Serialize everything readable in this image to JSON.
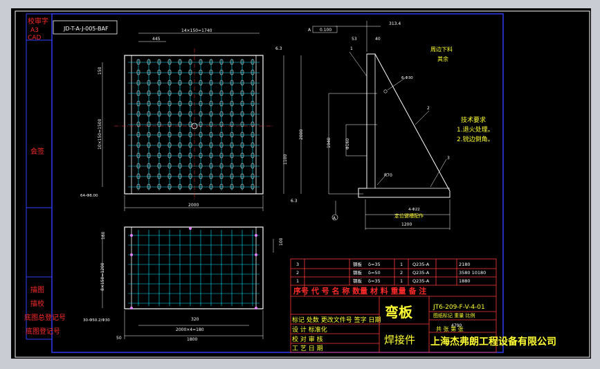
{
  "sheet": {
    "doc_code": "JD-T-A-J-005-BAF",
    "size": "A3",
    "cad": "CAD",
    "left_labels": {
      "top": "校审字",
      "mid": "会签",
      "b1": "描图",
      "b2": "描校",
      "b3": "底图总登记号",
      "b4": "底图登记号"
    }
  },
  "top_view": {
    "dim_top_a": "445",
    "dim_top_b": "14×150=1740",
    "dim_left_a": "150",
    "dim_left_b": "10×150=1500",
    "dim_right_a": "2000",
    "dim_right_b": "1100",
    "dim_bottom": "2000",
    "hole_note": "64-Φ8.00",
    "finish_a": "6.3",
    "finish_b": "6.3"
  },
  "side_view": {
    "dim_top_a": "313.4",
    "dim_top_b": "53",
    "dim_top_c": "40",
    "ref_box": "0.100",
    "ref_tag": "A",
    "part_1": "1",
    "part_2": "2",
    "part_3": "3",
    "hole_spec": "6-Φ30",
    "height_a": "1940",
    "height_b": "Φ160",
    "radius": "R70",
    "base_a": "4-Φ22",
    "base_b": "1200",
    "base_note": "定位键槽配作",
    "datum": "A",
    "roughness_note_a": "周边下料",
    "roughness_note_b": "其余"
  },
  "tech_req": {
    "title": "技术要求",
    "item1": "1.退火处理。",
    "item2": "2.锐边倒角。"
  },
  "bottom_view": {
    "dim_left_a": "180",
    "dim_left_b": "8×150=1200",
    "dim_right": "100",
    "dim_mid": "320",
    "dim_bottom_a": "2000×4=180",
    "dim_bottom_b": "1800",
    "dim_edge": "50",
    "hole_note": "30-Φ50.2/Φ30"
  },
  "parts_list": {
    "rows": [
      {
        "no": "3",
        "name": "钢板",
        "spec": "δ=35",
        "qty": "1",
        "mat": "Q235-A",
        "wt": "2180"
      },
      {
        "no": "2",
        "name": "钢板",
        "spec": "δ=50",
        "qty": "2",
        "mat": "Q235-A",
        "wt": "3580 10180"
      },
      {
        "no": "1",
        "name": "钢板",
        "spec": "δ=35",
        "qty": "1",
        "mat": "Q235-A",
        "wt": "1880"
      }
    ],
    "header": "序号  代  号  名    称  数量  材  料  重量  备  注"
  },
  "title_block": {
    "title": "弯板",
    "subtitle": "焊接件",
    "drawing_no": "JT6-209-F-V-4-01",
    "labels_row": "图纸标记 重量 比例",
    "sheets": "共 张  第 张",
    "weight": "4790",
    "company": "上海杰弗朗工程设备有限公司",
    "left_rows": [
      "标记 处数 更改文件号 签字 日期",
      "设  计  标准化",
      "校  对  审  核",
      "工  艺  日  期"
    ]
  }
}
